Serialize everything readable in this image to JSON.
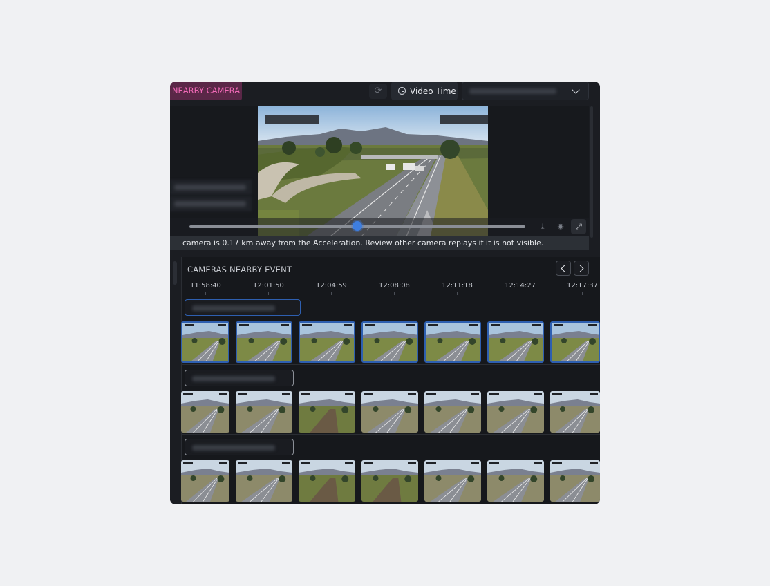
{
  "header": {
    "badge": "NEARBY CAMERA",
    "video_time_label": "Video Time",
    "refresh_icon": "refresh-icon",
    "camera_select_icon": "chevron-down-icon"
  },
  "player": {
    "progress": 0.5,
    "notice": "camera is 0.17 km away from the Acceleration. Review other camera replays if it is not visible.",
    "icons": [
      "download-icon",
      "eye-icon",
      "expand-icon"
    ]
  },
  "timeline": {
    "title": "CAMERAS NEARBY EVENT",
    "ticks": [
      "11:58:40",
      "12:01:50",
      "12:04:59",
      "12:08:08",
      "12:11:18",
      "12:14:27",
      "12:17:37"
    ],
    "prev_icon": "chevron-left-icon",
    "next_icon": "chevron-right-icon",
    "accent_color": "#2e5fb0"
  }
}
